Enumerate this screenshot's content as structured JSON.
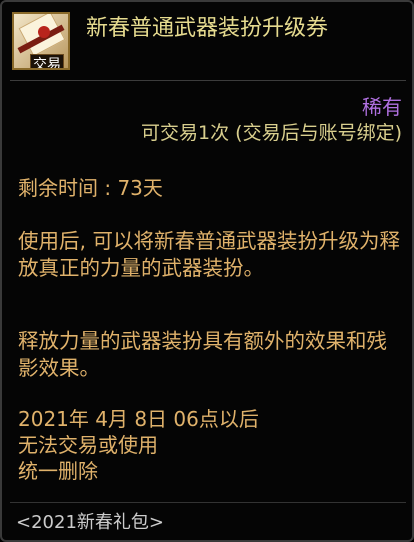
{
  "item": {
    "title": "新春普通武器装扮升级券",
    "icon": "scroll-coupon-icon",
    "trade_badge": "交易",
    "rarity": "稀有",
    "bind_info": "可交易1次 (交易后与账号绑定)",
    "remaining_time": "剩余时间 : 73天",
    "description_1": "使用后, 可以将新春普通武器装扮升级为释放真正的力量的武器装扮。",
    "description_2": "释放力量的武器装扮具有额外的效果和残影效果。",
    "expire_lines": [
      "2021年 4月 8日 06点以后",
      "无法交易或使用",
      "统一删除"
    ],
    "package_name": "<2021新春礼包>"
  },
  "colors": {
    "title": "#e6db8f",
    "rarity": "#b070e0",
    "body_text": "#e0b26b",
    "bind_text": "#d9cf8e",
    "package_text": "#cccccc"
  }
}
